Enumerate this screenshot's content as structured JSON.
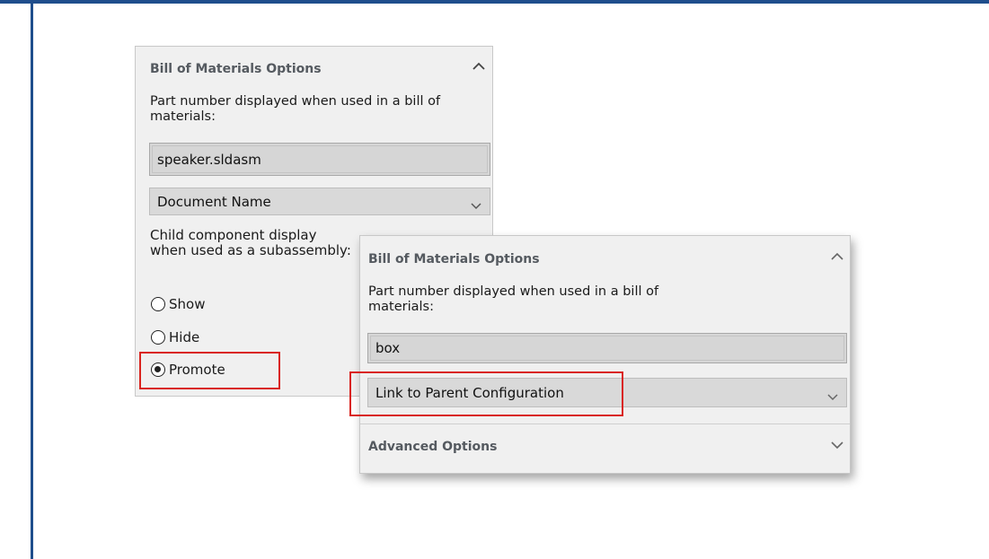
{
  "panel_a": {
    "title": "Bill of Materials Options",
    "description": "Part number displayed when used in a bill of materials:",
    "part_number_value": "speaker.sldasm",
    "name_source": "Document Name",
    "child_label": "Child component display when used as a subassembly:",
    "options": [
      "Show",
      "Hide",
      "Promote"
    ],
    "selected_option": "Promote"
  },
  "panel_b": {
    "title": "Bill of Materials Options",
    "description": "Part number displayed when used in a bill of materials:",
    "part_number_value": "box",
    "name_source": "Link to Parent Configuration",
    "advanced_title": "Advanced Options"
  },
  "colors": {
    "frame": "#1f4e8c",
    "highlight": "#d9231e",
    "panel_bg": "#f0f0f0"
  }
}
